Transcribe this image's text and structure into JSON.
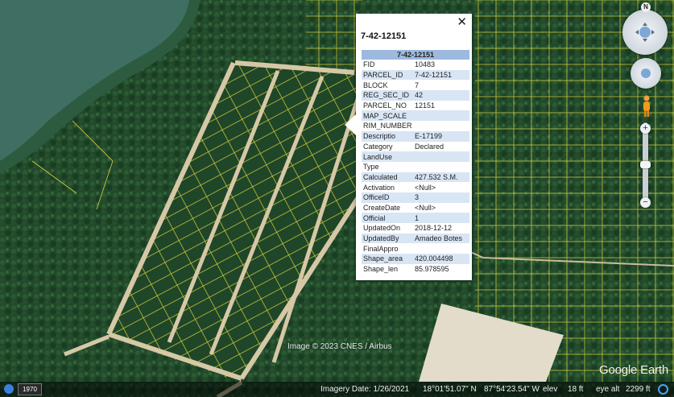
{
  "map": {
    "description_colors": {
      "sea": "#3e6f62",
      "forest": "#204a2a",
      "road": "#d6c8a6",
      "parcel_line": "#e8e044",
      "cleared": "#e3dccb"
    }
  },
  "popup": {
    "title": "7-42-12151",
    "table_header": "7-42-12151",
    "close_label": "✕",
    "rows": [
      {
        "key": "FID",
        "value": "10483"
      },
      {
        "key": "PARCEL_ID",
        "value": "7-42-12151"
      },
      {
        "key": "BLOCK",
        "value": "7"
      },
      {
        "key": "REG_SEC_ID",
        "value": "42"
      },
      {
        "key": "PARCEL_NO",
        "value": "12151"
      },
      {
        "key": "MAP_SCALE",
        "value": ""
      },
      {
        "key": "RIM_NUMBER",
        "value": ""
      },
      {
        "key": "Descriptio",
        "value": "E-17199"
      },
      {
        "key": "Category",
        "value": "Declared"
      },
      {
        "key": "LandUse",
        "value": ""
      },
      {
        "key": "Type",
        "value": ""
      },
      {
        "key": "Calculated",
        "value": "427.532 S.M."
      },
      {
        "key": "Activation",
        "value": "<Null>"
      },
      {
        "key": "OfficeID",
        "value": "3"
      },
      {
        "key": "CreateDate",
        "value": "<Null>"
      },
      {
        "key": "Official",
        "value": "1"
      },
      {
        "key": "UpdatedOn",
        "value": "2018-12-12"
      },
      {
        "key": "UpdatedBy",
        "value": "Amadeo Botes"
      },
      {
        "key": "FinalAppro",
        "value": ""
      },
      {
        "key": "Shape_area",
        "value": "420.004498"
      },
      {
        "key": "Shape_len",
        "value": "85.978595"
      }
    ]
  },
  "controls": {
    "north": "N",
    "zoom_in": "+",
    "zoom_out": "−"
  },
  "watermark": "Image © 2023 CNES / Airbus",
  "logo": "Google Earth",
  "statusbar": {
    "year": "1970",
    "imagery_date": "Imagery Date: 1/26/2021",
    "lat": "18°01'51.07\" N",
    "lon": "87°54'23.54\" W",
    "elev": "elev",
    "elev_value": "18 ft",
    "eye_alt": "eye alt",
    "eye_alt_value": "2299 ft"
  }
}
